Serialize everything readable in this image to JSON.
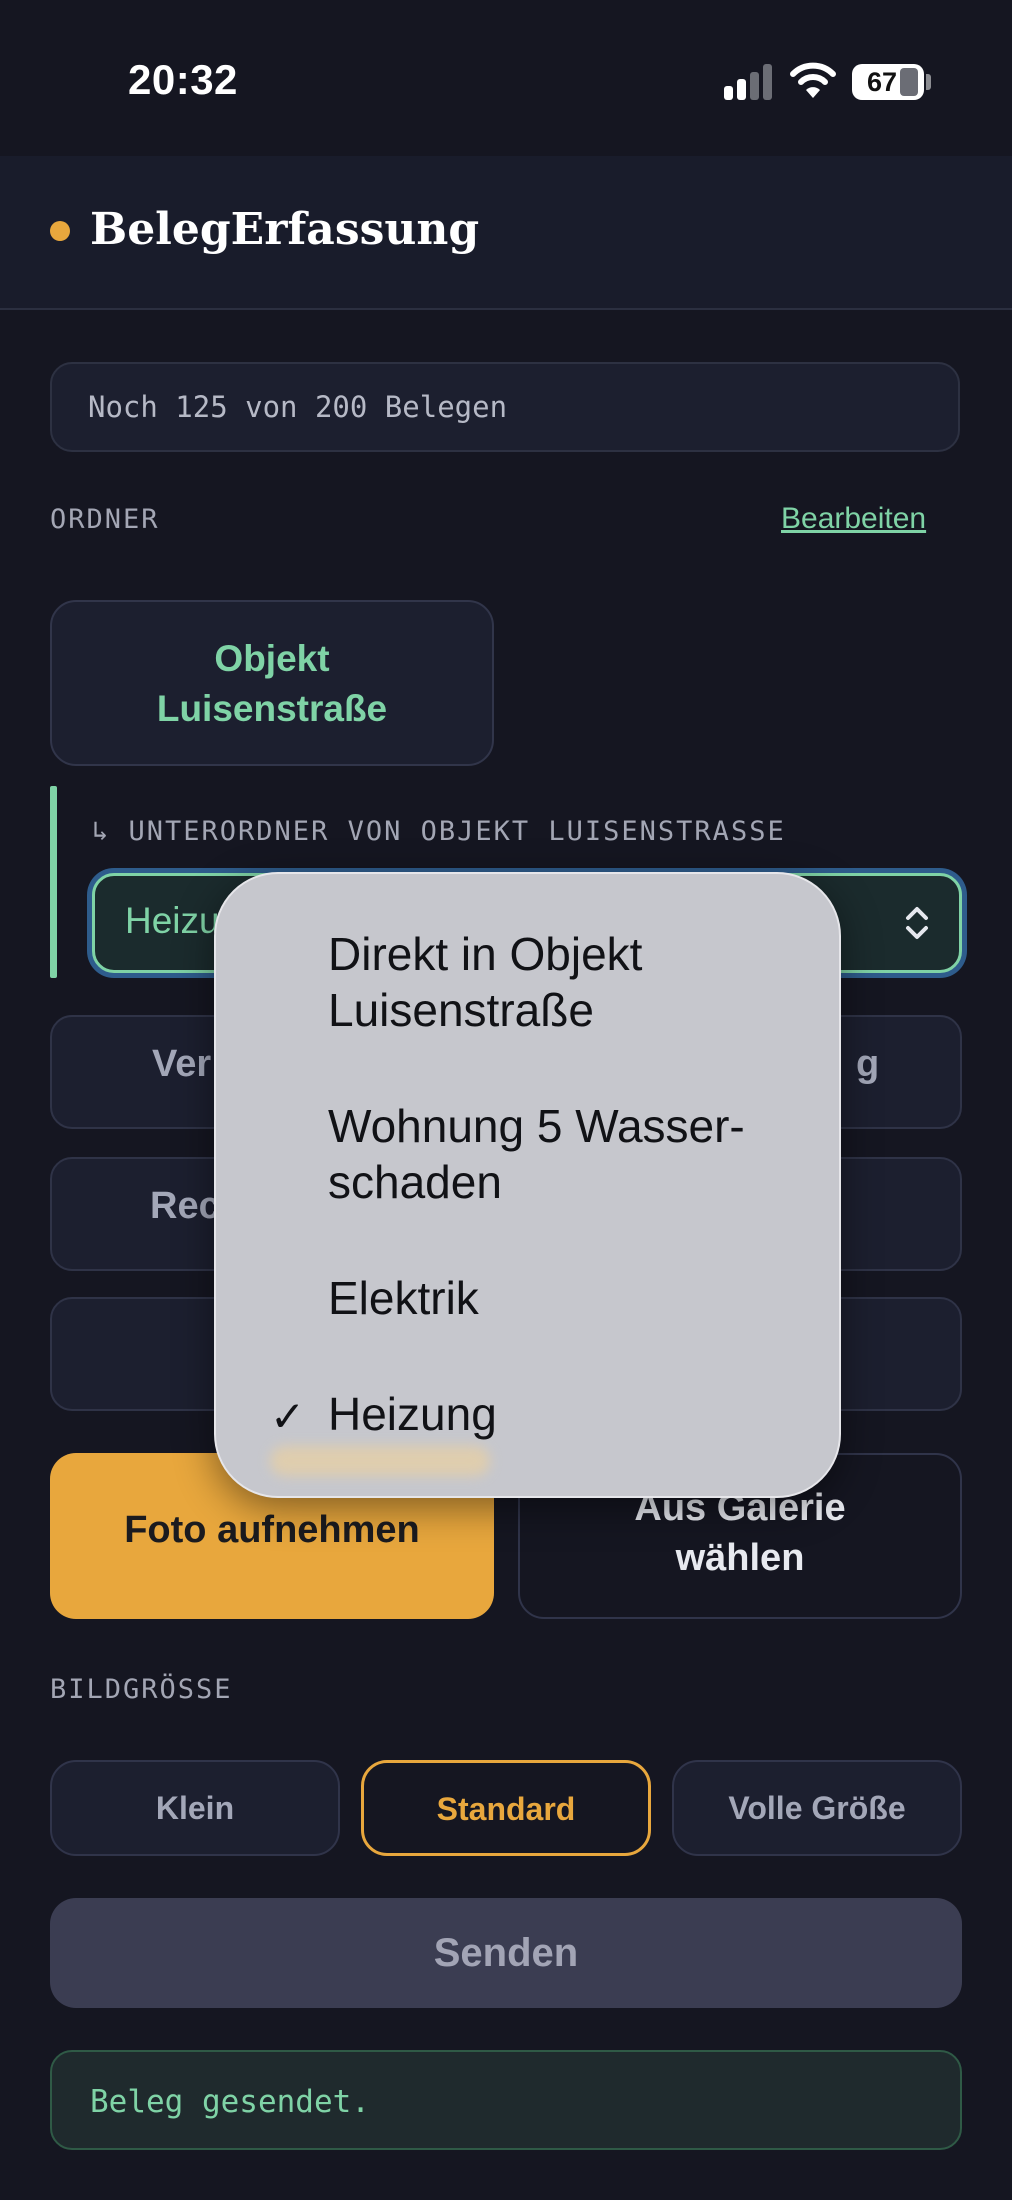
{
  "status_bar": {
    "time": "20:32",
    "battery": "67"
  },
  "header": {
    "title": "BelegErfassung"
  },
  "quota": {
    "text": "Noch 125 von 200 Belegen"
  },
  "folders": {
    "section_label": "ORDNER",
    "edit_link": "Bearbeiten",
    "selected_folder": "Objekt\nLuisenstraße",
    "subfolder_label": "↳ UNTERORDNER VON OBJEKT LUISENSTRASSE",
    "subfolder_select_value": "Heizung",
    "partial_buttons": [
      {
        "label_left": "Ver",
        "label_right": "g"
      },
      {
        "label_left": "Rec",
        "label_right": ""
      }
    ]
  },
  "actions": {
    "photo": "Foto aufnehmen",
    "gallery": "Aus Galerie wählen"
  },
  "image_size": {
    "section_label": "BILDGRÖSSE",
    "options": [
      "Klein",
      "Standard",
      "Volle Größe"
    ],
    "selected": "Standard"
  },
  "send_button": "Senden",
  "toast": "Beleg gesendet.",
  "menu": {
    "items": [
      {
        "label": "Direkt in Objekt Luisenstraße",
        "checked": false
      },
      {
        "label": "Wohnung 5 Wasser-schaden",
        "checked": false
      },
      {
        "label": "Elektrik",
        "checked": false
      },
      {
        "label": "Heizung",
        "checked": true
      }
    ],
    "check_glyph": "✓"
  },
  "colors": {
    "accent_green": "#7fd3a6",
    "accent_orange": "#e8a73d",
    "background": "#151621"
  }
}
